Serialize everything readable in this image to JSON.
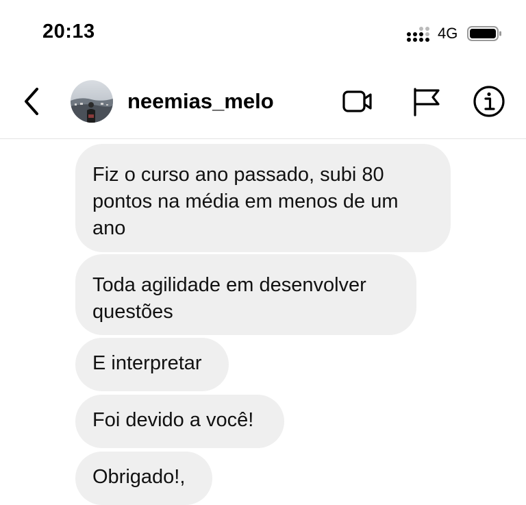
{
  "status_bar": {
    "time": "20:13",
    "network": "4G",
    "signal_icon": "signal-bars-icon",
    "battery_icon": "battery-icon"
  },
  "header": {
    "username": "neemias_melo",
    "back_icon": "chevron-left-icon",
    "video_icon": "video-camera-icon",
    "flag_icon": "flag-icon",
    "info_icon": "info-icon"
  },
  "messages": [
    {
      "text": "Fiz o curso ano passado, subi 80 pontos na média em menos de um ano"
    },
    {
      "text": "Toda agilidade em desenvolver questões"
    },
    {
      "text": "E interpretar"
    },
    {
      "text": "Foi devido a você!"
    },
    {
      "text": "Obrigado!,"
    }
  ],
  "colors": {
    "bubble_background": "#efefef",
    "divider": "#e3e3e3",
    "text": "#000000"
  }
}
